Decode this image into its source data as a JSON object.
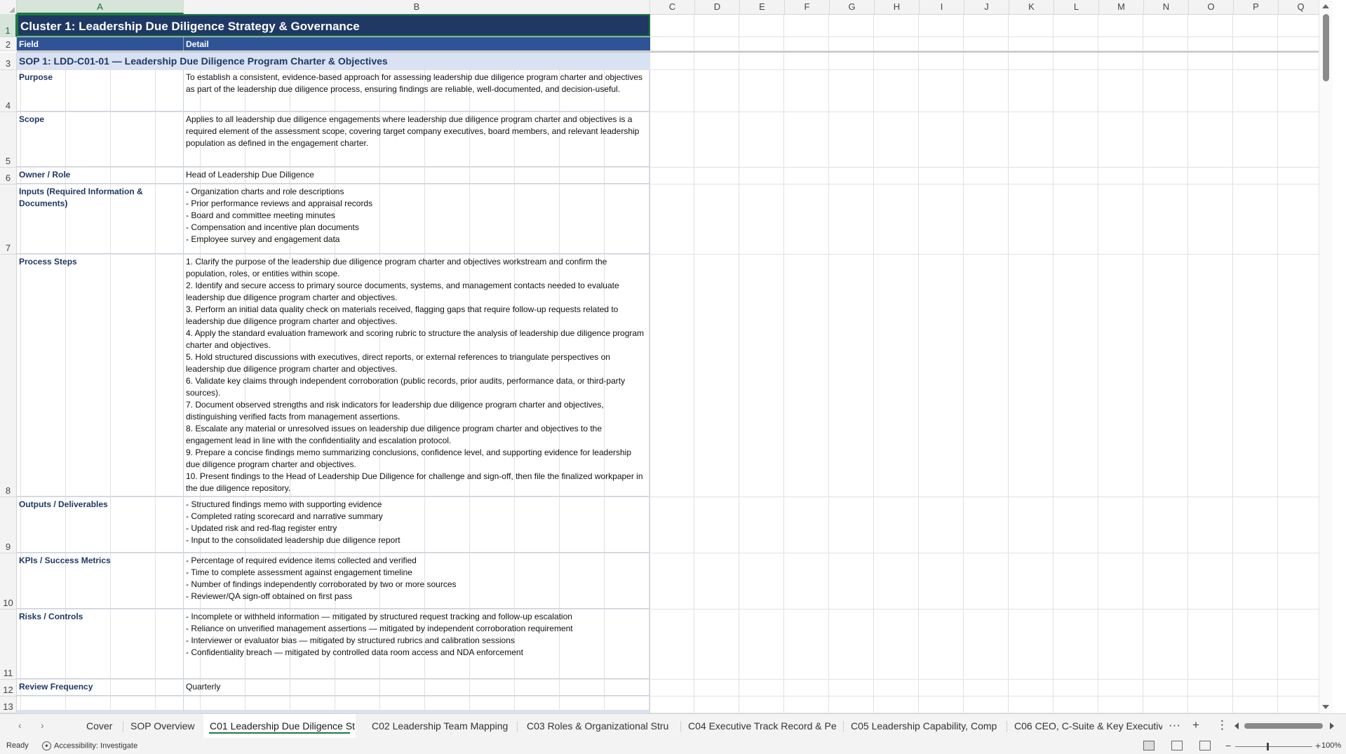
{
  "sheet": {
    "columns": [
      "A",
      "B",
      "C",
      "D",
      "E",
      "F",
      "G",
      "H",
      "I",
      "J",
      "K",
      "L",
      "M",
      "N",
      "O",
      "P",
      "Q"
    ],
    "selected_column": "A",
    "row_numbers": [
      "1",
      "2",
      "3",
      "4",
      "5",
      "6",
      "7",
      "8",
      "9",
      "10",
      "11",
      "12",
      "13"
    ],
    "title": "Cluster 1: Leadership Due Diligence Strategy & Governance",
    "header": {
      "field": "Field",
      "detail": "Detail"
    },
    "sop_title": "SOP 1: LDD-C01-01 — Leadership Due Diligence Program Charter & Objectives",
    "rows": [
      {
        "field": "Purpose",
        "detail": "To establish a consistent, evidence-based approach for assessing leadership due diligence program charter and objectives as part of the leadership due diligence process, ensuring findings are reliable, well-documented, and decision-useful."
      },
      {
        "field": "Scope",
        "detail": "Applies to all leadership due diligence engagements where leadership due diligence program charter and objectives is a required element of the assessment scope, covering target company executives, board members, and relevant leadership population as defined in the engagement charter."
      },
      {
        "field": "Owner / Role",
        "detail": "Head of Leadership Due Diligence"
      },
      {
        "field": "Inputs (Required Information & Documents)",
        "detail": "- Organization charts and role descriptions\n- Prior performance reviews and appraisal records\n- Board and committee meeting minutes\n- Compensation and incentive plan documents\n- Employee survey and engagement data"
      },
      {
        "field": "Process Steps",
        "detail": "1. Clarify the purpose of the leadership due diligence program charter and objectives workstream and confirm the population, roles, or entities within scope.\n2. Identify and secure access to primary source documents, systems, and management contacts needed to evaluate leadership due diligence program charter and objectives.\n3. Perform an initial data quality check on materials received, flagging gaps that require follow-up requests related to leadership due diligence program charter and objectives.\n4. Apply the standard evaluation framework and scoring rubric to structure the analysis of leadership due diligence program charter and objectives.\n5. Hold structured discussions with executives, direct reports, or external references to triangulate perspectives on leadership due diligence program charter and objectives.\n6. Validate key claims through independent corroboration (public records, prior audits, performance data, or third-party sources).\n7. Document observed strengths and risk indicators for leadership due diligence program charter and objectives, distinguishing verified facts from management assertions.\n8. Escalate any material or unresolved issues on leadership due diligence program charter and objectives to the engagement lead in line with the confidentiality and escalation protocol.\n9. Prepare a concise findings memo summarizing conclusions, confidence level, and supporting evidence for leadership due diligence program charter and objectives.\n10. Present findings to the Head of Leadership Due Diligence for challenge and sign-off, then file the finalized workpaper in the due diligence repository."
      },
      {
        "field": "Outputs / Deliverables",
        "detail": "- Structured findings memo with supporting evidence\n- Completed rating scorecard and narrative summary\n- Updated risk and red-flag register entry\n- Input to the consolidated leadership due diligence report"
      },
      {
        "field": "KPIs / Success Metrics",
        "detail": "- Percentage of required evidence items collected and verified\n- Time to complete assessment against engagement timeline\n- Number of findings independently corroborated by two or more sources\n- Reviewer/QA sign-off obtained on first pass"
      },
      {
        "field": "Risks / Controls",
        "detail": "- Incomplete or withheld information — mitigated by structured request tracking and follow-up escalation\n- Reliance on unverified management assertions — mitigated by independent corroboration requirement\n- Interviewer or evaluator bias — mitigated by structured rubrics and calibration sessions\n- Confidentiality breach — mitigated by controlled data room access and NDA enforcement"
      },
      {
        "field": "Review Frequency",
        "detail": "Quarterly"
      }
    ]
  },
  "tabs": [
    {
      "label": "Cover",
      "active": false
    },
    {
      "label": "SOP Overview",
      "active": false
    },
    {
      "label": "C01 Leadership Due Diligence St",
      "active": true
    },
    {
      "label": "C02 Leadership Team Mapping",
      "active": false
    },
    {
      "label": "C03 Roles & Organizational Stru",
      "active": false
    },
    {
      "label": "C04 Executive Track Record & Pe",
      "active": false
    },
    {
      "label": "C05 Leadership Capability, Comp",
      "active": false
    },
    {
      "label": "C06 CEO, C-Suite & Key Executiv",
      "active": false
    }
  ],
  "tabbar": {
    "more": "···",
    "add": "+",
    "options": "⋮",
    "prev": "‹",
    "next": "›"
  },
  "status": {
    "ready": "Ready",
    "accessibility": "Accessibility: Investigate",
    "zoom": "100%",
    "zoom_minus": "−",
    "zoom_plus": "+"
  },
  "colors": {
    "title_bg": "#1f3864",
    "header_bg": "#2f5496",
    "sop_bg": "#d9e2f3",
    "selection": "#1e7a42"
  }
}
